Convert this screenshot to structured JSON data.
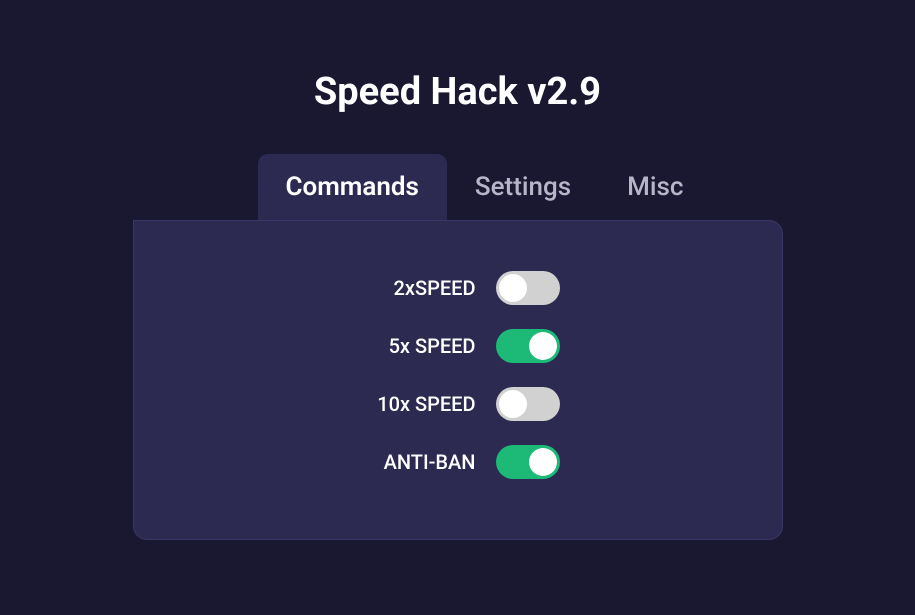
{
  "title": "Speed Hack v2.9",
  "tabs": [
    {
      "label": "Commands",
      "active": true
    },
    {
      "label": "Settings",
      "active": false
    },
    {
      "label": "Misc",
      "active": false
    }
  ],
  "toggles": [
    {
      "label": "2xSPEED",
      "enabled": false
    },
    {
      "label": "5x SPEED",
      "enabled": true
    },
    {
      "label": "10x SPEED",
      "enabled": false
    },
    {
      "label": "ANTI-BAN",
      "enabled": true
    }
  ]
}
